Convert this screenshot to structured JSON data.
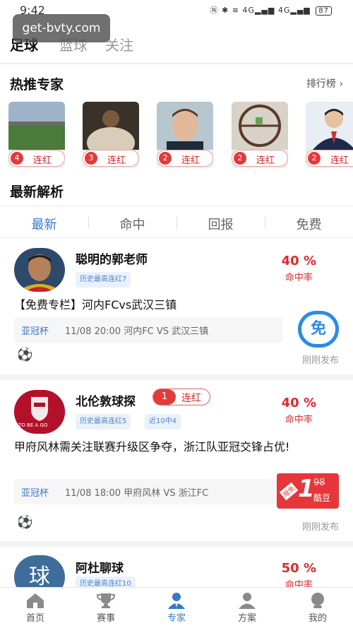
{
  "status": {
    "time": "9:42",
    "battery": "87",
    "signal_left": "4G",
    "signal_right": "4G"
  },
  "watermark": "get-bvty.com",
  "sport_tabs": [
    {
      "label": "足球",
      "active": true
    },
    {
      "label": "篮球",
      "active": false
    },
    {
      "label": "关注",
      "active": false
    }
  ],
  "hot_experts": {
    "title": "热推专家",
    "rank_link": "排行榜",
    "cards": [
      {
        "streak": "4",
        "label": "连红"
      },
      {
        "streak": "3",
        "label": "连红"
      },
      {
        "streak": "2",
        "label": "连红"
      },
      {
        "streak": "2",
        "label": "连红"
      },
      {
        "streak": "2",
        "label": "连红"
      }
    ]
  },
  "latest": {
    "title": "最新解析",
    "filters": [
      "最新",
      "命中",
      "回报",
      "免费"
    ],
    "active_filter": "最新"
  },
  "posts": [
    {
      "author": "聪明的郭老师",
      "tags": [
        "历史最高连红7"
      ],
      "hit_rate": "40 %",
      "hit_rate_label": "命中率",
      "title": "【免费专栏】河内FCvs武汉三镇",
      "league": "亚冠杯",
      "match_info": "11/08 20:00  河内FC VS 武汉三镇",
      "price_type": "免",
      "posted": "刚刚发布"
    },
    {
      "author": "北伦敦球探",
      "streak_num": "1",
      "streak_label": "连红",
      "tags": [
        "历史最高连红5",
        "近10中4"
      ],
      "hit_rate": "40 %",
      "hit_rate_label": "命中率",
      "title": "甲府风林需关注联赛升级区争夺，浙江队亚冠交锋占优!",
      "league": "亚冠杯",
      "match_info": "11/08 18:00  甲府风林 VS 浙江FC",
      "price_now": "1",
      "price_old": "98",
      "price_unit": "酷豆",
      "price_tag": "限免",
      "posted": "刚刚发布",
      "avatar_text": "TO BE A GO"
    },
    {
      "author": "阿杜聊球",
      "avatar_char": "球",
      "tags": [
        "历史最高连红10"
      ],
      "hit_rate": "50 %",
      "hit_rate_label": "命中率"
    }
  ],
  "bottom_nav": [
    {
      "label": "首页",
      "icon": "home-icon",
      "active": false
    },
    {
      "label": "赛事",
      "icon": "trophy-icon",
      "active": false
    },
    {
      "label": "专家",
      "icon": "expert-icon",
      "active": true
    },
    {
      "label": "方案",
      "icon": "plan-icon",
      "active": false
    },
    {
      "label": "我的",
      "icon": "profile-icon",
      "active": false
    }
  ],
  "colors": {
    "accent_blue": "#3a77c8",
    "accent_red": "#e0282e"
  }
}
